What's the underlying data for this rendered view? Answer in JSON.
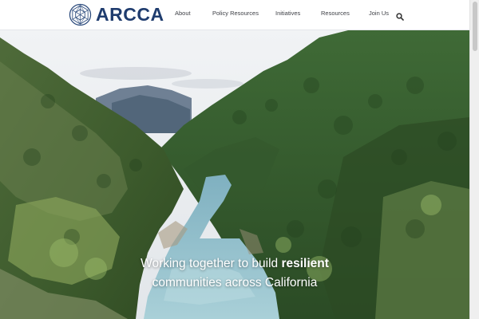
{
  "brand": {
    "name": "ARCCA"
  },
  "nav": {
    "items": [
      {
        "label": "About"
      },
      {
        "label": "Policy Resources"
      },
      {
        "label": "Initiatives"
      },
      {
        "label": "Resources"
      },
      {
        "label": "Join Us"
      }
    ]
  },
  "hero": {
    "tagline_part1": "Working together to build ",
    "tagline_bold": "resilient",
    "tagline_part2": "communities across California"
  },
  "colors": {
    "brand_navy": "#1f3c6e",
    "nav_text": "#3d3f45"
  }
}
